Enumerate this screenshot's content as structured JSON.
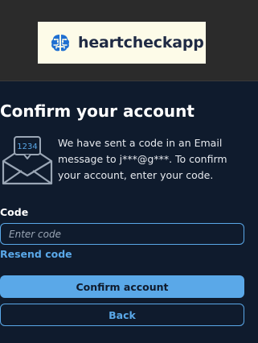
{
  "header": {
    "brand_name": "heartcheckapp",
    "logo_icon": "brain-icon",
    "logo_background": "#fdfbe8"
  },
  "main": {
    "title": "Confirm your account",
    "illustration": {
      "icon": "envelope-code-icon",
      "code_badge": "1234"
    },
    "message": "We have sent a code in an Email message to j***@g***. To confirm your account, enter your code.",
    "code_field": {
      "label": "Code",
      "placeholder": "Enter code",
      "value": ""
    },
    "resend_link": "Resend code",
    "confirm_button": "Confirm account",
    "back_button": "Back"
  },
  "colors": {
    "background": "#0f1b2d",
    "top_bar": "#2b2b2b",
    "accent": "#5aa8e8",
    "text": "#ffffff"
  }
}
